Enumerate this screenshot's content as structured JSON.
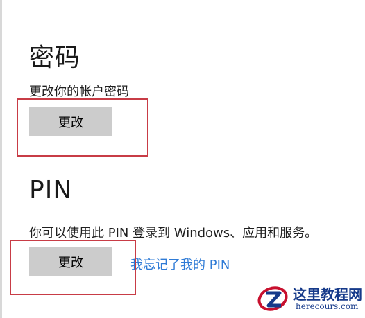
{
  "password_section": {
    "title": "密码",
    "description": "更改你的帐户密码",
    "change_button": "更改"
  },
  "pin_section": {
    "title": "PIN",
    "description": "你可以使用此 PIN 登录到 Windows、应用和服务。",
    "change_button": "更改",
    "forgot_link": "我忘记了我的 PIN"
  },
  "watermark": {
    "title": "这里教程网",
    "url": "herecours.com"
  },
  "colors": {
    "highlight": "#c83c46",
    "link": "#2f7bd6",
    "button_bg": "#cccccc"
  }
}
